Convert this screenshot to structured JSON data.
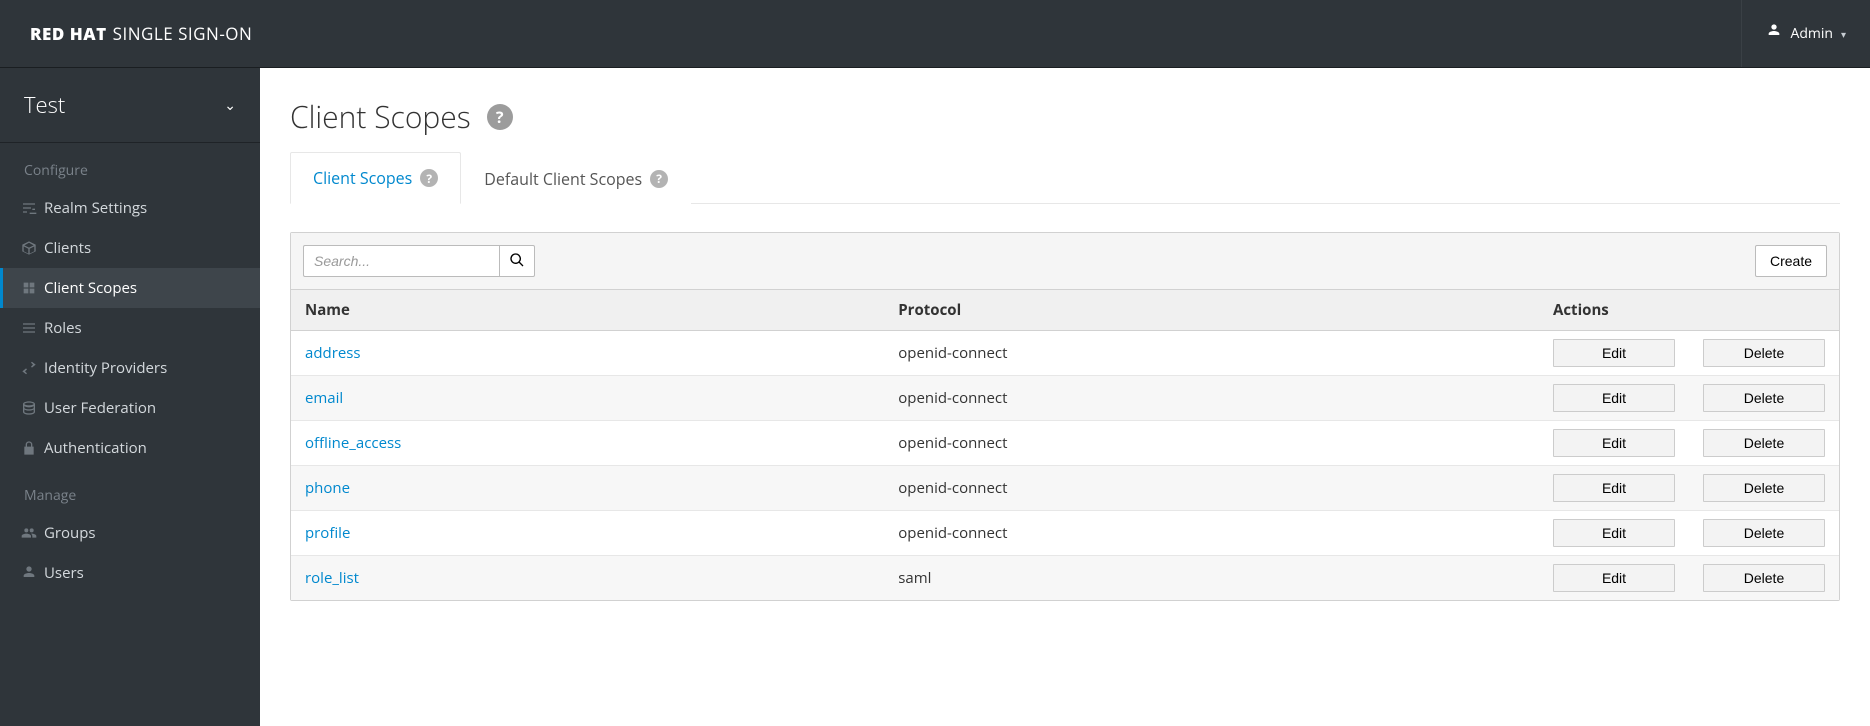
{
  "brand": {
    "bold": "RED HAT",
    "light": "SINGLE SIGN-ON"
  },
  "user": {
    "name": "Admin"
  },
  "realm": {
    "name": "Test"
  },
  "sidebar": {
    "configure_label": "Configure",
    "manage_label": "Manage",
    "configure": [
      {
        "label": "Realm Settings"
      },
      {
        "label": "Clients"
      },
      {
        "label": "Client Scopes"
      },
      {
        "label": "Roles"
      },
      {
        "label": "Identity Providers"
      },
      {
        "label": "User Federation"
      },
      {
        "label": "Authentication"
      }
    ],
    "manage": [
      {
        "label": "Groups"
      },
      {
        "label": "Users"
      }
    ]
  },
  "page": {
    "title": "Client Scopes"
  },
  "tabs": [
    {
      "label": "Client Scopes"
    },
    {
      "label": "Default Client Scopes"
    }
  ],
  "toolbar": {
    "search_placeholder": "Search...",
    "create_label": "Create"
  },
  "table": {
    "headers": {
      "name": "Name",
      "protocol": "Protocol",
      "actions": "Actions"
    },
    "edit_label": "Edit",
    "delete_label": "Delete",
    "rows": [
      {
        "name": "address",
        "protocol": "openid-connect"
      },
      {
        "name": "email",
        "protocol": "openid-connect"
      },
      {
        "name": "offline_access",
        "protocol": "openid-connect"
      },
      {
        "name": "phone",
        "protocol": "openid-connect"
      },
      {
        "name": "profile",
        "protocol": "openid-connect"
      },
      {
        "name": "role_list",
        "protocol": "saml"
      }
    ]
  }
}
